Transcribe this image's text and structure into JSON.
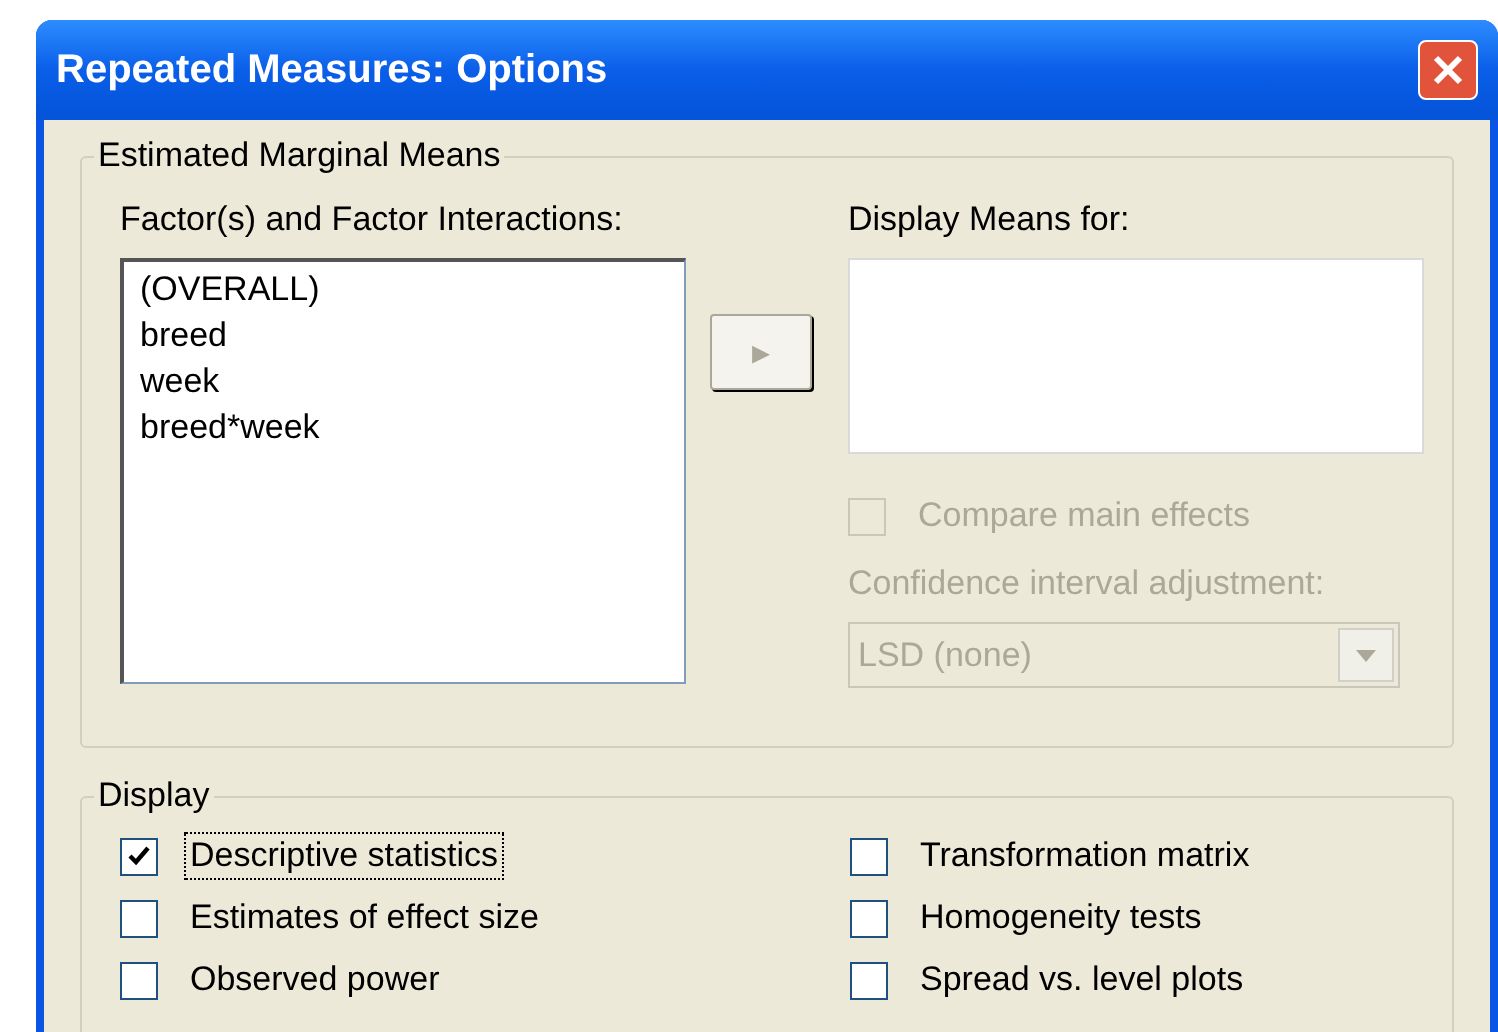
{
  "window": {
    "title": "Repeated Measures: Options"
  },
  "estimated_marginal_means": {
    "title": "Estimated Marginal Means",
    "factors_label": "Factor(s) and Factor Interactions:",
    "factors": [
      "(OVERALL)",
      "breed",
      "week",
      "breed*week"
    ],
    "move_button": {
      "label": "▸",
      "disabled": true
    },
    "display_means_label": "Display Means for:",
    "compare_main_effects": {
      "label": "Compare main effects",
      "checked": false,
      "disabled": true
    },
    "ci_adjustment_label": "Confidence interval adjustment:",
    "ci_adjustment": {
      "value": "LSD (none)",
      "disabled": true
    }
  },
  "display": {
    "title": "Display",
    "options": [
      {
        "label": "Descriptive statistics",
        "checked": true,
        "focused": true
      },
      {
        "label": "Transformation matrix",
        "checked": false,
        "focused": false
      },
      {
        "label": "Estimates of effect size",
        "checked": false,
        "focused": false
      },
      {
        "label": "Homogeneity tests",
        "checked": false,
        "focused": false
      },
      {
        "label": "Observed power",
        "checked": false,
        "focused": false
      },
      {
        "label": "Spread vs. level plots",
        "checked": false,
        "focused": false
      }
    ]
  }
}
